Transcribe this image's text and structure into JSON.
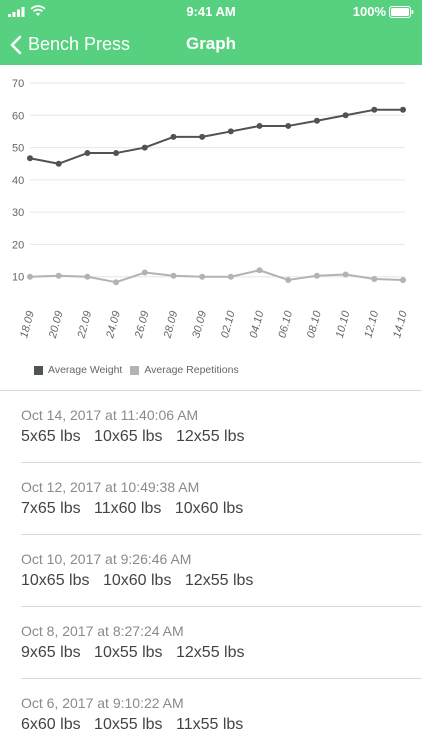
{
  "status_bar": {
    "time": "9:41 AM",
    "battery": "100%"
  },
  "nav": {
    "back_label": "Bench Press",
    "title": "Graph"
  },
  "chart_data": {
    "type": "line",
    "categories": [
      "18.09",
      "20.09",
      "22.09",
      "24.09",
      "26.09",
      "28.09",
      "30.09",
      "02.10",
      "04.10",
      "06.10",
      "08.10",
      "10.10",
      "12.10",
      "14.10"
    ],
    "ylim": [
      0,
      70
    ],
    "yticks": [
      10,
      20,
      30,
      40,
      50,
      60,
      70
    ],
    "grid": true,
    "legend_position": "bottom-left",
    "series": [
      {
        "name": "Average Weight",
        "color": "#4e5451",
        "values": [
          46.7,
          45.0,
          48.3,
          48.3,
          50.0,
          53.3,
          53.3,
          55.0,
          56.7,
          56.7,
          58.3,
          60.0,
          61.7,
          61.7
        ]
      },
      {
        "name": "Average Repetitions",
        "color": "#b3b3b3",
        "values": [
          10.0,
          10.3,
          10.0,
          8.3,
          11.3,
          10.3,
          10.0,
          10.0,
          12.0,
          9.0,
          10.3,
          10.7,
          9.3,
          9.0
        ]
      }
    ]
  },
  "workouts": [
    {
      "date": "Oct 14, 2017 at 11:40:06 AM",
      "sets": [
        "5x65 lbs",
        "10x65 lbs",
        "12x55 lbs"
      ]
    },
    {
      "date": "Oct 12, 2017 at 10:49:38 AM",
      "sets": [
        "7x65 lbs",
        "11x60 lbs",
        "10x60 lbs"
      ]
    },
    {
      "date": "Oct 10, 2017 at 9:26:46 AM",
      "sets": [
        "10x65 lbs",
        "10x60 lbs",
        "12x55 lbs"
      ]
    },
    {
      "date": "Oct 8, 2017 at 8:27:24 AM",
      "sets": [
        "9x65 lbs",
        "10x55 lbs",
        "12x55 lbs"
      ]
    },
    {
      "date": "Oct 6, 2017 at 9:10:22 AM",
      "sets": [
        "6x60 lbs",
        "10x55 lbs",
        "11x55 lbs"
      ]
    }
  ]
}
